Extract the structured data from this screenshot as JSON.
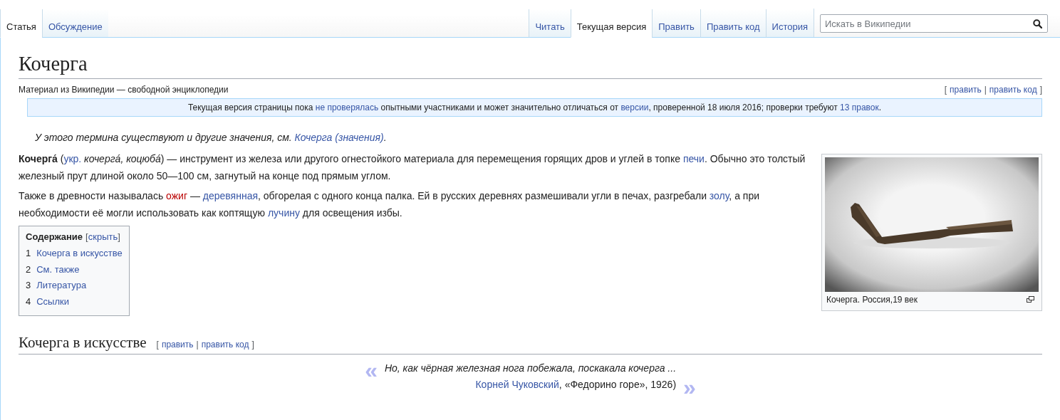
{
  "tabs_left": [
    {
      "label": "Статья",
      "selected": true
    },
    {
      "label": "Обсуждение",
      "selected": false
    }
  ],
  "tabs_right": [
    {
      "label": "Читать",
      "selected": false
    },
    {
      "label": "Текущая версия",
      "selected": true
    },
    {
      "label": "Править",
      "selected": false
    },
    {
      "label": "Править код",
      "selected": false
    },
    {
      "label": "История",
      "selected": false
    }
  ],
  "search": {
    "placeholder": "Искать в Википедии"
  },
  "article": {
    "title": "Кочерга",
    "tagline": "Материал из Википедии — свободной энциклопедии",
    "edit_section": {
      "open": "[",
      "links": [
        "править",
        "править код"
      ],
      "separator": "|",
      "close": "]"
    },
    "notice": [
      {
        "kind": "text",
        "text": "Текущая версия страницы пока "
      },
      {
        "kind": "link",
        "text": "не проверялась"
      },
      {
        "kind": "text",
        "text": " опытными участниками и может значительно отличаться от "
      },
      {
        "kind": "link",
        "text": "версии"
      },
      {
        "kind": "text",
        "text": ", проверенной 18 июля 2016; проверки требуют "
      },
      {
        "kind": "link",
        "text": "13 правок"
      },
      {
        "kind": "text",
        "text": "."
      }
    ],
    "hatnote": [
      {
        "kind": "text",
        "text": "У этого термина существуют и другие значения, см. "
      },
      {
        "kind": "link",
        "text": "Кочерга (значения)"
      },
      {
        "kind": "text",
        "text": "."
      }
    ],
    "paragraphs": [
      [
        {
          "kind": "bold",
          "text": "Кочерга́"
        },
        {
          "kind": "text",
          "text": " ("
        },
        {
          "kind": "link",
          "text": "укр."
        },
        {
          "kind": "italic",
          "text": " кочергá, коцюбá"
        },
        {
          "kind": "text",
          "text": ") — инструмент из железа или другого огнестойкого материала для перемещения горящих дров и углей в топке "
        },
        {
          "kind": "link",
          "text": "печи"
        },
        {
          "kind": "text",
          "text": ". Обычно это толстый железный прут длиной около 50—100 см, загнутый на конце под прямым углом."
        }
      ],
      [
        {
          "kind": "text",
          "text": "Также в древности называлась "
        },
        {
          "kind": "redlink",
          "text": "ожиг"
        },
        {
          "kind": "text",
          "text": " — "
        },
        {
          "kind": "link",
          "text": "деревянная"
        },
        {
          "kind": "text",
          "text": ", обгорелая с одного конца палка. Ей в русских деревнях размешивали угли в печах, разгребали "
        },
        {
          "kind": "link",
          "text": "золу"
        },
        {
          "kind": "text",
          "text": ", а при необходимости её могли использовать как коптящую "
        },
        {
          "kind": "link",
          "text": "лучину"
        },
        {
          "kind": "text",
          "text": " для освещения избы."
        }
      ]
    ],
    "figure": {
      "caption": "Кочерга. Россия,19 век"
    },
    "toc": {
      "title": "Содержание",
      "toggle": {
        "open": "[",
        "label": "скрыть",
        "close": "]"
      },
      "items": [
        {
          "number": "1",
          "label": "Кочерга в искусстве"
        },
        {
          "number": "2",
          "label": "См. также"
        },
        {
          "number": "3",
          "label": "Литература"
        },
        {
          "number": "4",
          "label": "Ссылки"
        }
      ]
    },
    "sections": [
      {
        "heading": "Кочерга в искусстве",
        "edit_section": {
          "open": "[",
          "links": [
            "править",
            "править код"
          ],
          "separator": "|",
          "close": "]"
        },
        "quote": {
          "open_mark": "«",
          "text": "Но, как чёрная железная нога побежала, поскакала кочерга ...",
          "source": [
            {
              "kind": "link",
              "text": "Корней Чуковский"
            },
            {
              "kind": "text",
              "text": ", «Федорино горе», 1926)"
            }
          ],
          "close_mark": "»"
        }
      }
    ]
  }
}
